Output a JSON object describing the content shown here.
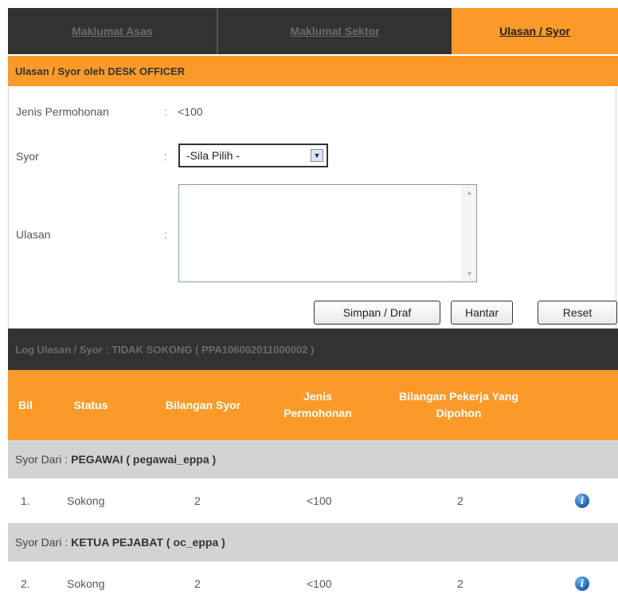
{
  "tabs": [
    {
      "label": "Maklumat Asas"
    },
    {
      "label": "Maklumat Sektor"
    },
    {
      "label": "Ulasan / Syor"
    }
  ],
  "section_title": "Ulasan / Syor oleh DESK OFFICER",
  "form": {
    "jenis_label": "Jenis Permohonan",
    "jenis_value": "<100",
    "syor_label": "Syor",
    "syor_selected": "-Sila Pilih -",
    "ulasan_label": "Ulasan",
    "ulasan_value": "",
    "colon": ":"
  },
  "buttons": {
    "simpan": "Simpan / Draf",
    "hantar": "Hantar",
    "reset": "Reset"
  },
  "log": {
    "title": "Log Ulasan / Syor : TIDAK SOKONG ( PPA106002011000002 )",
    "columns": {
      "bil": "Bil",
      "status": "Status",
      "bilangan_syor": "Bilangan Syor",
      "jenis_line1": "Jenis",
      "jenis_line2": "Permohonan",
      "pekerja_line1": "Bilangan Pekerja Yang",
      "pekerja_line2": "Dipohon"
    },
    "groups": [
      {
        "prefix": "Syor Dari :",
        "name": "PEGAWAI ( pegawai_eppa )",
        "row": {
          "bil": "1.",
          "status": "Sokong",
          "bilangan_syor": "2",
          "jenis": "<100",
          "pekerja": "2"
        }
      },
      {
        "prefix": "Syor Dari :",
        "name": "KETUA PEJABAT ( oc_eppa )",
        "row": {
          "bil": "2.",
          "status": "Sokong",
          "bilangan_syor": "2",
          "jenis": "<100",
          "pekerja": "2"
        }
      }
    ]
  },
  "colors": {
    "orange": "#fb9a28",
    "dark": "#333230",
    "grey_row": "#d3d3d3"
  }
}
